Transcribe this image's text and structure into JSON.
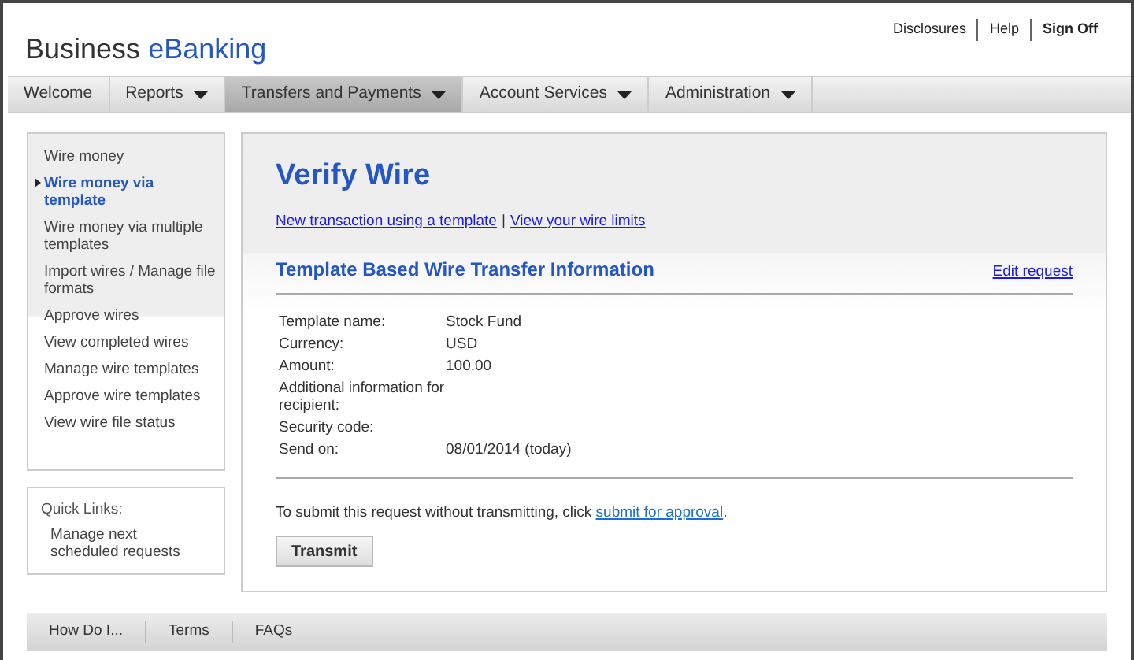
{
  "header": {
    "brand_plain": "Business",
    "brand_accent": "eBanking",
    "links": [
      {
        "label": "Disclosures",
        "bold": false
      },
      {
        "label": "Help",
        "bold": false
      },
      {
        "label": "Sign Off",
        "bold": true
      }
    ]
  },
  "nav": [
    {
      "label": "Welcome",
      "has_menu": false,
      "selected": false
    },
    {
      "label": "Reports",
      "has_menu": true,
      "selected": false
    },
    {
      "label": "Transfers and Payments",
      "has_menu": true,
      "selected": true
    },
    {
      "label": "Account Services",
      "has_menu": true,
      "selected": false
    },
    {
      "label": "Administration",
      "has_menu": true,
      "selected": false
    }
  ],
  "sidebar": {
    "items": [
      {
        "label": "Wire money",
        "selected": false
      },
      {
        "label": "Wire money via template",
        "selected": true
      },
      {
        "label": "Wire money via multiple templates",
        "selected": false
      },
      {
        "label": "Import wires / Manage file formats",
        "selected": false
      },
      {
        "label": "Approve wires",
        "selected": false
      },
      {
        "label": "View completed wires",
        "selected": false
      },
      {
        "label": "Manage wire templates",
        "selected": false
      },
      {
        "label": "Approve wire templates",
        "selected": false
      },
      {
        "label": "View wire file status",
        "selected": false
      }
    ]
  },
  "quick_links": {
    "title": "Quick Links:",
    "items": [
      "Manage next scheduled requests"
    ]
  },
  "main": {
    "title": "Verify Wire",
    "links": [
      "New transaction using a template",
      "View your wire limits"
    ],
    "link_separator": "|",
    "section_title": "Template Based Wire Transfer Information",
    "edit_link": "Edit request",
    "fields": [
      {
        "label": "Template name:",
        "value": "Stock Fund"
      },
      {
        "label": "Currency:",
        "value": "USD"
      },
      {
        "label": "Amount:",
        "value": "100.00"
      },
      {
        "label": "Additional information for recipient:"
      },
      {
        "label": "Security code:"
      },
      {
        "label": "Send on:",
        "value": "08/01/2014 (today)"
      }
    ],
    "note_prefix": "To submit this request without transmitting, click ",
    "note_link": "submit for approval",
    "note_suffix": ".",
    "button": "Transmit"
  },
  "footer": [
    "How Do I...",
    "Terms",
    "FAQs"
  ]
}
